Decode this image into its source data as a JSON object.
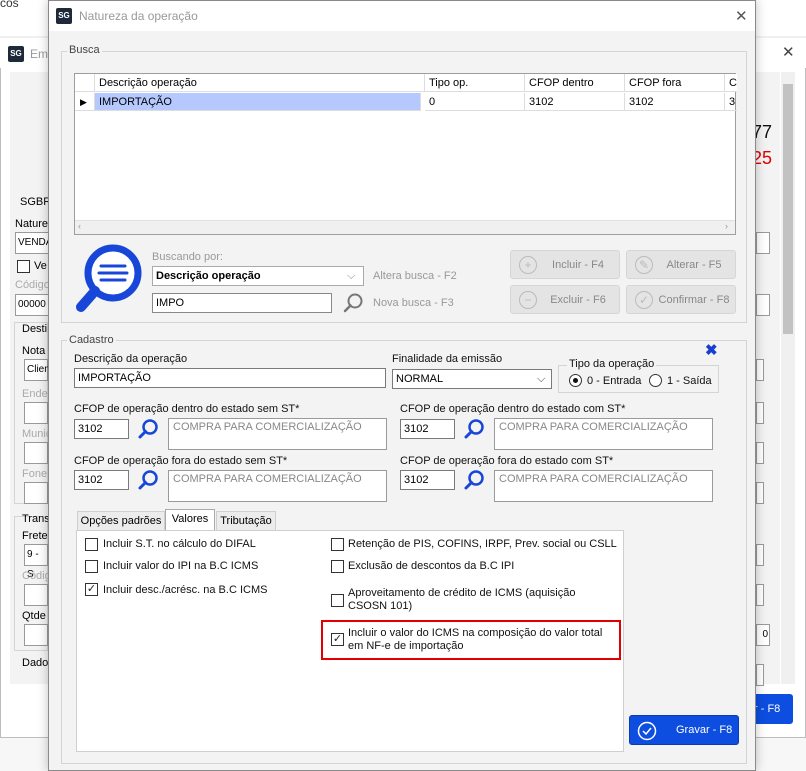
{
  "background_window": {
    "top_fragment": "cos",
    "title_fragment": "Em",
    "close_icon": "close-icon",
    "labels": {
      "sgbr": "SGBR",
      "nature": "Nature",
      "venda": "VENDA",
      "ve": "Ve",
      "codigo": "Código",
      "codigo_val": "00000",
      "dest": "Desti",
      "nota": "Nota",
      "clien": "Clien",
      "ende": "Ende",
      "munic": "Munic",
      "fone": "Fone",
      "trans": "Trans",
      "frete": "Frete",
      "frete_val": "9 - S",
      "codig2": "Códig",
      "qtde": "Qtde",
      "dado": "Dado",
      "num1": "77",
      "num2": "25",
      "f8_fragment": "r - F8",
      "zero_fragment": "0"
    },
    "accent_red": "#e00000"
  },
  "dialog": {
    "logo": "SG",
    "title": "Natureza da operação",
    "close_icon": "close-icon",
    "busca": {
      "legend": "Busca",
      "grid": {
        "columns": [
          "Descrição operação",
          "Tipo op.",
          "CFOP dentro",
          "CFOP fora",
          "C"
        ],
        "rows": [
          [
            "IMPORTAÇÃO",
            "0",
            "3102",
            "3102",
            "3"
          ]
        ]
      },
      "search_icon": "search-icon",
      "buscando_por_label": "Buscando por:",
      "buscando_por_value": "Descrição operação",
      "altera_busca": "Altera busca - F2",
      "search_value": "IMPO",
      "nova_busca": "Nova busca - F3",
      "buttons": {
        "incluir": "Incluir - F4",
        "alterar": "Alterar - F5",
        "excluir": "Excluir - F6",
        "confirmar": "Confirmar - F8"
      }
    },
    "cadastro": {
      "legend": "Cadastro",
      "descricao_label": "Descrição da operação",
      "descricao_value": "IMPORTAÇÃO",
      "finalidade_label": "Finalidade da emissão",
      "finalidade_value": "NORMAL",
      "tipo_label": "Tipo da operação",
      "tipo_entrada": "0 - Entrada",
      "tipo_saida": "1 - Saída",
      "cfop_dentro_sem_label": "CFOP de operação dentro do estado sem ST*",
      "cfop_dentro_sem_value": "3102",
      "cfop_dentro_sem_desc": "COMPRA PARA COMERCIALIZAÇÃO",
      "cfop_dentro_com_label": "CFOP de operação dentro do estado com ST*",
      "cfop_dentro_com_value": "3102",
      "cfop_dentro_com_desc": "COMPRA PARA COMERCIALIZAÇÃO",
      "cfop_fora_sem_label": "CFOP de operação fora do estado sem ST*",
      "cfop_fora_sem_value": "3102",
      "cfop_fora_sem_desc": "COMPRA PARA COMERCIALIZAÇÃO",
      "cfop_fora_com_label": "CFOP de operação fora do estado com ST*",
      "cfop_fora_com_value": "3102",
      "cfop_fora_com_desc": "COMPRA PARA COMERCIALIZAÇÃO",
      "tabs": [
        "Opções padrões",
        "Valores",
        "Tributação"
      ],
      "checks": {
        "st_difal": "Incluir S.T. no cálculo do DIFAL",
        "ipi_bc": "Incluir valor do IPI na B.C ICMS",
        "desc_acresc": "Incluir desc./acrésc. na B.C ICMS",
        "retencao": "Retenção de PIS, COFINS, IRPF, Prev. social ou CSLL",
        "exclusao": "Exclusão de descontos da B.C IPI",
        "aproveitamento_1": "Aproveitamento de crédito de ICMS (aquisição",
        "aproveitamento_2": "CSOSN 101)",
        "incluir_icms_1": "Incluir o valor do ICMS na composição do valor total",
        "incluir_icms_2": "em NF-e de importação"
      },
      "gravar": "Gravar - F8"
    },
    "colors": {
      "primary_button": "#0d4de0",
      "selection": "#b5c9ff",
      "highlight": "#e00000",
      "close_blue": "#1a3fcf"
    }
  }
}
